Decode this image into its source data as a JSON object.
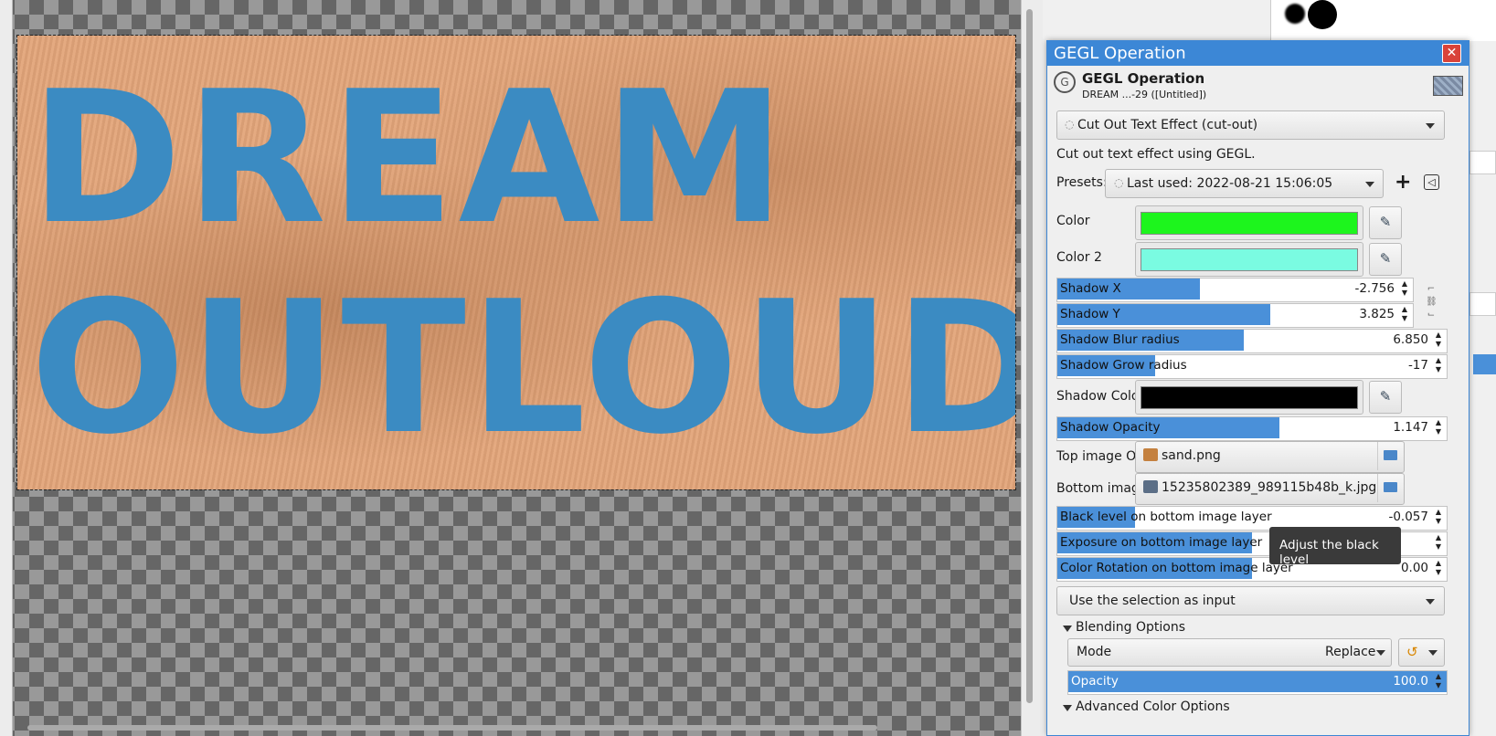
{
  "canvas": {
    "line1": "DREAM",
    "line2": "OUTLOUD!"
  },
  "dialog": {
    "window_title": "GEGL Operation",
    "close_symbol": "✕",
    "header_title": "GEGL Operation",
    "header_subtitle": "DREAM ...-29 ([Untitled])",
    "operation": "Cut Out Text Effect (cut-out)",
    "description": "Cut out text effect using GEGL.",
    "presets_label": "Presets:",
    "preset_value": "Last used: 2022-08-21 15:06:05",
    "add_preset_symbol": "+",
    "preset_menu_symbol": "◁",
    "color_label": "Color",
    "color_value": "#1df51d",
    "color2_label": "Color 2",
    "color2_value": "#7afbe1",
    "shadow_x": {
      "label": "Shadow X",
      "value": "-2.756",
      "fill_fraction": 0.4
    },
    "shadow_y": {
      "label": "Shadow  Y",
      "value": "3.825",
      "fill_fraction": 0.6
    },
    "shadow_blur": {
      "label": "Shadow Blur radius",
      "value": "6.850",
      "fill_fraction": 0.48
    },
    "shadow_grow": {
      "label": "Shadow Grow radius",
      "value": "-17",
      "fill_fraction": 0.25
    },
    "shadow_color_label": "Shadow Color",
    "shadow_color_value": "#000000",
    "shadow_opacity": {
      "label": "Shadow Opacity",
      "value": "1.147",
      "fill_fraction": 0.57
    },
    "top_overlay_label": "Top image Overlay",
    "top_overlay_file": "sand.png",
    "bottom_overlay_label": "Bottom image overlay",
    "bottom_overlay_file": "15235802389_989115b48b_k.jpg",
    "black_level": {
      "label": "Black level on bottom image layer",
      "value": "-0.057",
      "fill_fraction": 0.2
    },
    "exposure": {
      "label": "Exposure on bottom image layer",
      "value": "",
      "fill_fraction": 0.5
    },
    "color_rotation": {
      "label": "Color Rotation on bottom image layer",
      "value": "0.00",
      "fill_fraction": 0.5
    },
    "tooltip": "Adjust the black level",
    "input_mode": "Use the selection as input",
    "blending_options": "Blending Options",
    "mode_label": "Mode",
    "mode_value": "Replace",
    "opacity": {
      "label": "Opacity",
      "value": "100.0",
      "fill_fraction": 1.0
    },
    "advanced_color_options": "Advanced Color Options"
  }
}
